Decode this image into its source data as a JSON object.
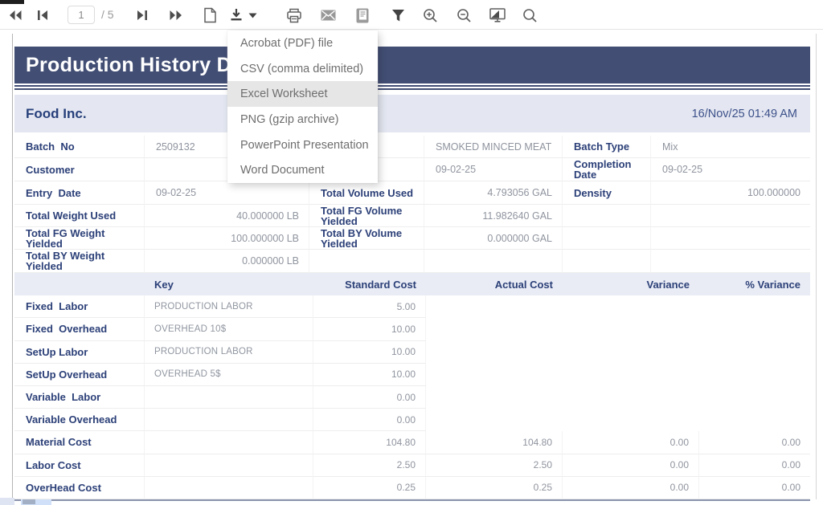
{
  "toolbar": {
    "page_value": "1",
    "page_total_label": "/ 5",
    "icons": [
      "fast-backward-icon",
      "previous-page-icon",
      "next-page-icon",
      "fast-forward-icon",
      "new-document-icon",
      "export-download-icon",
      "export-caret-icon",
      "print-icon",
      "email-icon",
      "export-report-icon",
      "filter-icon",
      "zoom-in-icon",
      "zoom-out-icon",
      "fit-screen-icon",
      "search-icon"
    ]
  },
  "export_menu": {
    "items": [
      "Acrobat (PDF) file",
      "CSV (comma delimited)",
      "Excel Worksheet",
      "PNG (gzip archive)",
      "PowerPoint Presentation",
      "Word Document"
    ],
    "highlighted_item": "Excel Worksheet"
  },
  "report": {
    "title": "Production History D",
    "company": "Food Inc.",
    "timestamp": "16/Nov/25 01:49 AM",
    "info_table": {
      "rows": [
        {
          "cells": [
            "Batch  No",
            "2509132",
            "",
            "SMOKED MINCED MEAT",
            "Batch Type",
            "Mix"
          ],
          "align": [
            "l",
            "l",
            "l",
            "l",
            "l",
            "l"
          ]
        },
        {
          "cells": [
            "Customer",
            "",
            "",
            "09-02-25",
            "Completion Date",
            "09-02-25"
          ],
          "align": [
            "l",
            "l",
            "l",
            "l",
            "l",
            "l"
          ]
        },
        {
          "cells": [
            "Entry  Date",
            "09-02-25",
            "Total Volume Used",
            "4.793056 GAL",
            "Density",
            "100.000000"
          ],
          "align": [
            "l",
            "l",
            "l",
            "r",
            "l",
            "r"
          ]
        },
        {
          "cells": [
            "Total Weight Used",
            "40.000000 LB",
            "Total FG Volume Yielded",
            "11.982640 GAL",
            "",
            ""
          ],
          "align": [
            "l",
            "r",
            "l",
            "r",
            "l",
            "l"
          ]
        },
        {
          "cells": [
            "Total FG Weight Yielded",
            "100.000000 LB",
            "Total BY Volume Yielded",
            "0.000000 GAL",
            "",
            ""
          ],
          "align": [
            "l",
            "r",
            "l",
            "r",
            "l",
            "l"
          ]
        },
        {
          "cells": [
            "Total BY Weight Yielded",
            "0.000000 LB",
            "",
            "",
            "",
            ""
          ],
          "align": [
            "l",
            "r",
            "l",
            "l",
            "l",
            "l"
          ]
        }
      ]
    },
    "cost_table": {
      "headers": [
        "",
        "Key",
        "Standard Cost",
        "Actual Cost",
        "Variance",
        "% Variance"
      ],
      "full_border_from_row": 6,
      "rows": [
        [
          "Fixed  Labor",
          "PRODUCTION LABOR",
          "5.00",
          "",
          "",
          ""
        ],
        [
          "Fixed  Overhead",
          "OVERHEAD 10$",
          "10.00",
          "",
          "",
          ""
        ],
        [
          "SetUp Labor",
          "PRODUCTION LABOR",
          "10.00",
          "",
          "",
          ""
        ],
        [
          "SetUp Overhead",
          "OVERHEAD 5$",
          "10.00",
          "",
          "",
          ""
        ],
        [
          "Variable  Labor",
          "",
          "0.00",
          "",
          "",
          ""
        ],
        [
          "Variable Overhead",
          "",
          "0.00",
          "",
          "",
          ""
        ],
        [
          "Material Cost",
          "",
          "104.80",
          "104.80",
          "0.00",
          "0.00"
        ],
        [
          "Labor Cost",
          "",
          "2.50",
          "2.50",
          "0.00",
          "0.00"
        ],
        [
          "OverHead Cost",
          "",
          "0.25",
          "0.25",
          "0.00",
          "0.00"
        ]
      ]
    }
  },
  "colors": {
    "title_bar": "#424e74",
    "label_navy": "#2c4078",
    "value_gray": "#8f949e",
    "band_lavender": "#e4e7f1",
    "cost_header": "#e9ecf5",
    "menu_highlight": "#e6e6e6"
  }
}
